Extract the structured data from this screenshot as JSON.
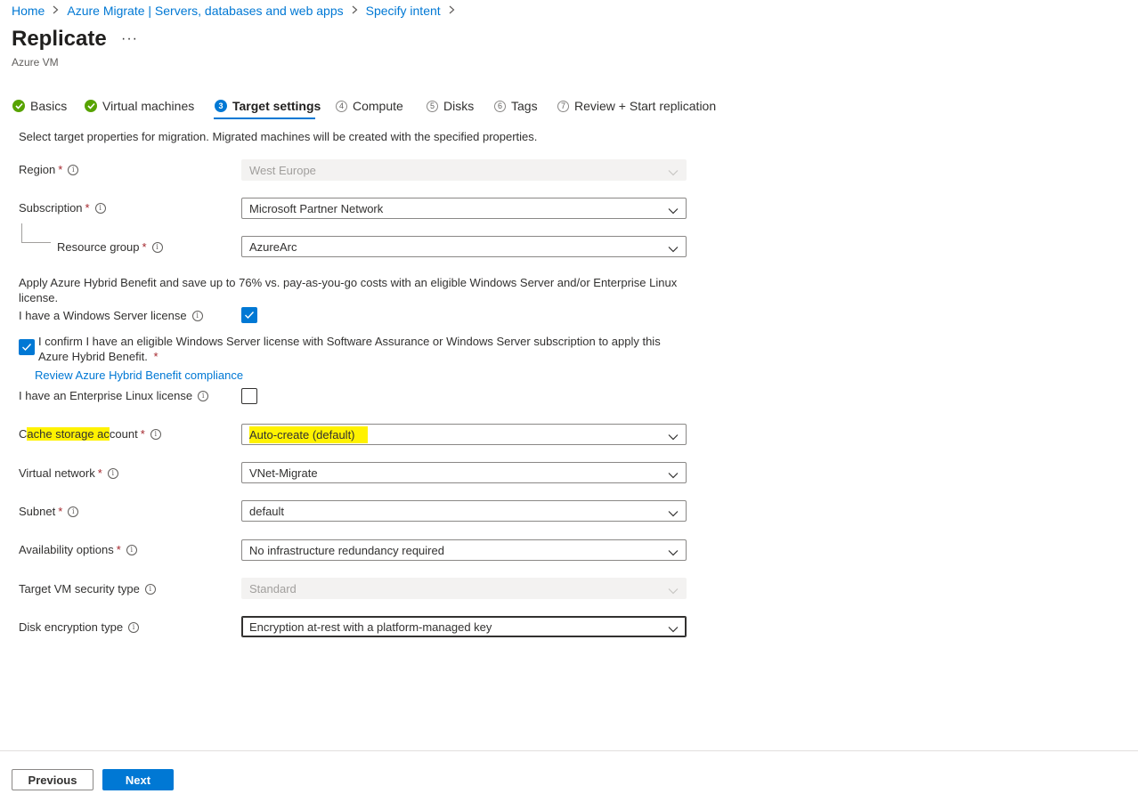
{
  "breadcrumb": {
    "items": [
      "Home",
      "Azure Migrate | Servers, databases and web apps",
      "Specify intent"
    ]
  },
  "header": {
    "title": "Replicate",
    "more": "···",
    "subtitle": "Azure VM"
  },
  "tabs": [
    {
      "label": "Basics",
      "state": "complete"
    },
    {
      "label": "Virtual machines",
      "state": "complete"
    },
    {
      "label": "Target settings",
      "state": "active",
      "number": "3"
    },
    {
      "label": "Compute",
      "state": "pending",
      "number": "4"
    },
    {
      "label": "Disks",
      "state": "pending",
      "number": "5"
    },
    {
      "label": "Tags",
      "state": "pending",
      "number": "6"
    },
    {
      "label": "Review + Start replication",
      "state": "pending",
      "number": "7"
    }
  ],
  "intro": "Select target properties for migration. Migrated machines will be created with the specified properties.",
  "form": {
    "region": {
      "label": "Region",
      "required": "*",
      "value": "West Europe",
      "disabled": true
    },
    "subscription": {
      "label": "Subscription",
      "required": "*",
      "value": "Microsoft Partner Network"
    },
    "resource_group": {
      "label": "Resource group",
      "required": "*",
      "value": "AzureArc"
    },
    "hybrid_benefit_text": "Apply Azure Hybrid Benefit and save up to 76% vs. pay-as-you-go costs with an eligible Windows Server and/or Enterprise Linux license.",
    "windows_license": {
      "label": "I have a Windows Server license",
      "checked": true
    },
    "confirm": {
      "text": "I confirm I have an eligible Windows Server license with Software Assurance  or Windows Server subscription to apply this Azure Hybrid Benefit.",
      "required": "*",
      "checked": true
    },
    "compliance_link": "Review Azure Hybrid Benefit compliance",
    "linux_license": {
      "label": "I have an Enterprise Linux license",
      "checked": false
    },
    "cache_storage": {
      "label_prefix": "C",
      "label_highlight": "ache storage ac",
      "label_suffix": "count",
      "required": "*",
      "value": "Auto-create (default)"
    },
    "virtual_network": {
      "label": "Virtual network",
      "required": "*",
      "value": "VNet-Migrate"
    },
    "subnet": {
      "label": "Subnet",
      "required": "*",
      "value": "default"
    },
    "availability": {
      "label": "Availability options",
      "required": "*",
      "value": "No infrastructure redundancy required"
    },
    "security_type": {
      "label": "Target VM security type",
      "value": "Standard",
      "disabled": true
    },
    "disk_encryption": {
      "label": "Disk encryption type",
      "value": "Encryption at-rest with a platform-managed key"
    }
  },
  "footer": {
    "previous": "Previous",
    "next": "Next"
  },
  "colors": {
    "accent": "#0078d4",
    "success": "#57a300",
    "required": "#a4262c",
    "highlight": "#fff200"
  }
}
